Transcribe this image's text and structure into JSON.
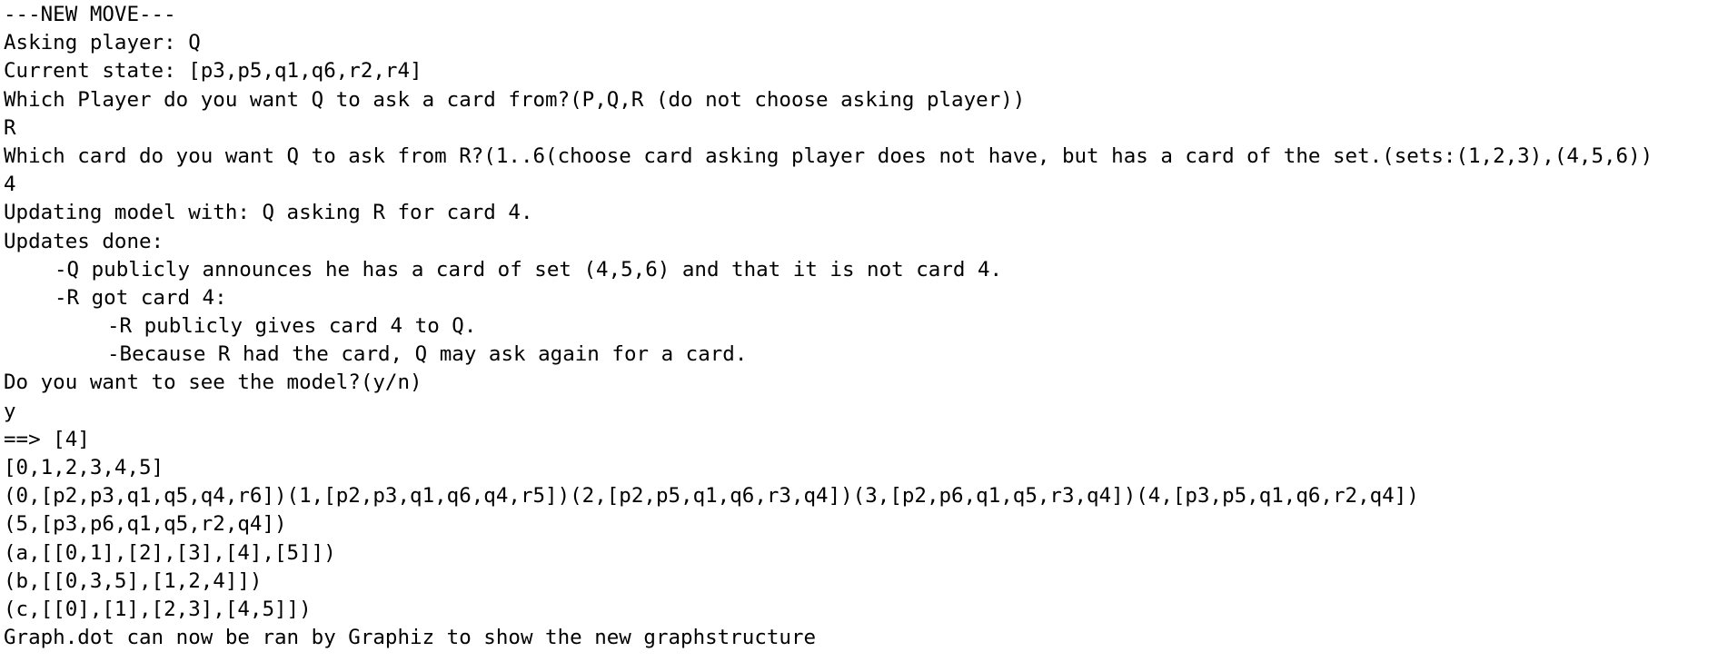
{
  "console": {
    "lines": [
      "---NEW MOVE---",
      "Asking player: Q",
      "Current state: [p3,p5,q1,q6,r2,r4]",
      "Which Player do you want Q to ask a card from?(P,Q,R (do not choose asking player))",
      "R",
      "Which card do you want Q to ask from R?(1..6(choose card asking player does not have, but has a card of the set.(sets:(1,2,3),(4,5,6))",
      "4",
      "Updating model with: Q asking R for card 4.",
      "Updates done:",
      "-Q publicly announces he has a card of set (4,5,6) and that it is not card 4.",
      "-R got card 4:",
      "-R publicly gives card 4 to Q.",
      "-Because R had the card, Q may ask again for a card.",
      "Do you want to see the model?(y/n)",
      "y",
      "==> [4]",
      "[0,1,2,3,4,5]",
      "(0,[p2,p3,q1,q5,q4,r6])(1,[p2,p3,q1,q6,q4,r5])(2,[p2,p5,q1,q6,r3,q4])(3,[p2,p6,q1,q5,r3,q4])(4,[p3,p5,q1,q6,r2,q4])",
      "(5,[p3,p6,q1,q5,r2,q4])",
      "(a,[[0,1],[2],[3],[4],[5]])",
      "(b,[[0,3,5],[1,2,4]])",
      "(c,[[0],[1],[2,3],[4,5]])",
      "Graph.dot can now be ran by Graphiz to show the new graphstructure"
    ]
  }
}
